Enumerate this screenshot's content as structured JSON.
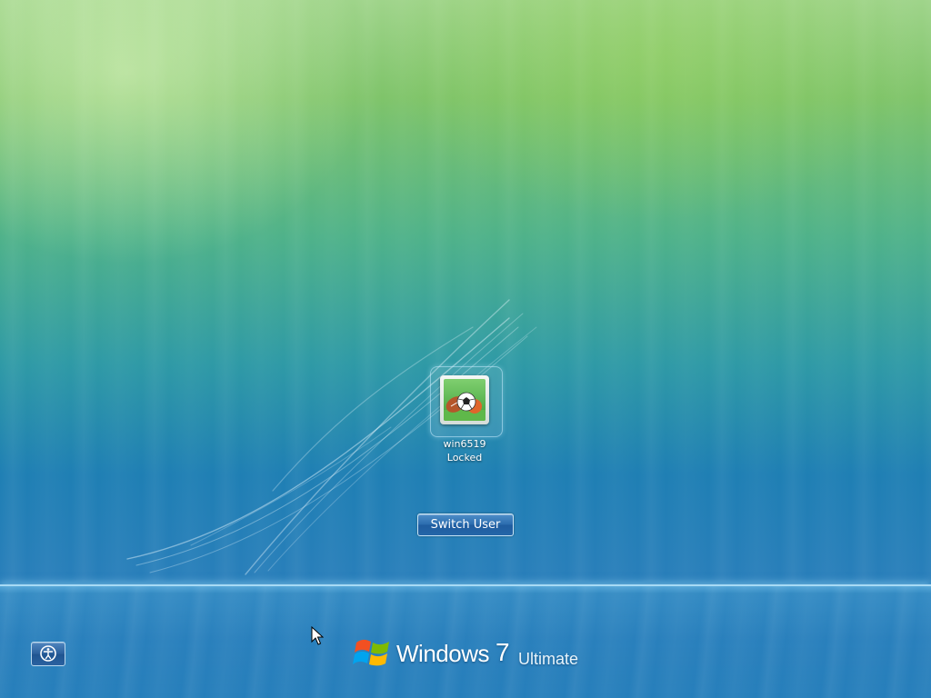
{
  "lock_screen": {
    "user": {
      "name": "win6519",
      "status": "Locked",
      "picture_icon": "sports-balls-icon"
    },
    "switch_user_label": "Switch User",
    "ease_of_access_icon": "ease-of-access-icon"
  },
  "branding": {
    "product_name": "Windows",
    "version": "7",
    "edition": "Ultimate",
    "logo_icon": "windows-flag-icon"
  },
  "colors": {
    "button_blue": "#2b6cae",
    "background_green": "#7fc46a",
    "background_blue": "#1f7fb4"
  }
}
